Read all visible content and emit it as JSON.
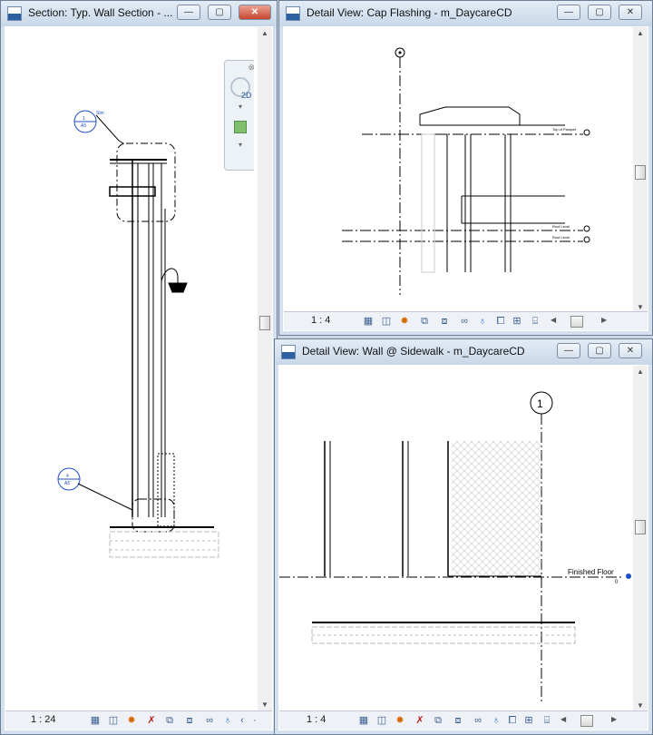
{
  "windows": {
    "section": {
      "title": "Section: Typ. Wall Section - ...",
      "scale": "1 : 24",
      "callout_top_label": "1\nA5",
      "callout_top_sub": "Sim",
      "callout_bottom_label": "4\nA5"
    },
    "cap_flashing": {
      "title": "Detail View: Cap Flashing - m_DaycareCD",
      "scale": "1 : 4",
      "grid_bubble": "1",
      "level_1": "Top of Parapet",
      "level_2": "Roof Level",
      "level_3": "Roof Level"
    },
    "sidewalk": {
      "title": "Detail View: Wall @ Sidewalk - m_DaycareCD",
      "scale": "1 : 4",
      "grid_bubble": "1",
      "level_label": "Finished Floor",
      "level_value": "0"
    }
  },
  "window_buttons": {
    "minimize": "—",
    "restore": "▢",
    "close": "✕"
  },
  "navbar": {
    "label_2d": "2D"
  },
  "view_control_icons": [
    "detail-level-icon",
    "visual-style-icon",
    "sun-path-icon",
    "shadows-icon",
    "crop-view-icon",
    "show-crop-icon",
    "temporary-hide-icon",
    "reveal-hidden-icon",
    "lightbulb-icon",
    "worksharing-icon"
  ],
  "colors": {
    "accent_blue": "#1e4fc4",
    "title_bar": "#d4e0ee"
  }
}
